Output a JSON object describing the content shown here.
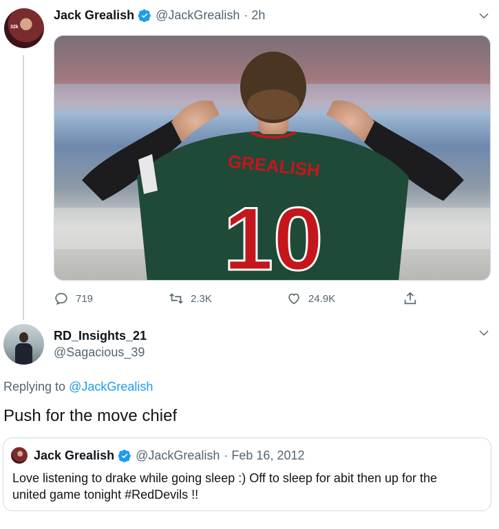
{
  "tweet": {
    "author_name": "Jack Grealish",
    "handle": "@JackGrealish",
    "time": "· 2h",
    "verified": true,
    "media": {
      "jersey_name": "GREALISH",
      "jersey_number": "10"
    },
    "actions": {
      "replies": "719",
      "retweets": "2.3K",
      "likes": "24.9K"
    }
  },
  "reply": {
    "author_name": "RD_Insights_21",
    "handle": "@Sagacious_39",
    "replying_prefix": "Replying to",
    "replying_to": "@JackGrealish",
    "text": "Push for the move chief"
  },
  "quoted": {
    "author_name": "Jack Grealish",
    "handle": "@JackGrealish",
    "date": "· Feb 16, 2012",
    "verified": true,
    "text_line1": "Love listening to drake while going sleep :) Off to sleep for abit then up for the",
    "text_line2": "united game tonight #RedDevils !!"
  },
  "colors": {
    "accent": "#1d9bf0",
    "muted": "#536471",
    "border": "#cfd9de",
    "jersey_green": "#1f4a38",
    "jersey_red": "#c4161c"
  }
}
